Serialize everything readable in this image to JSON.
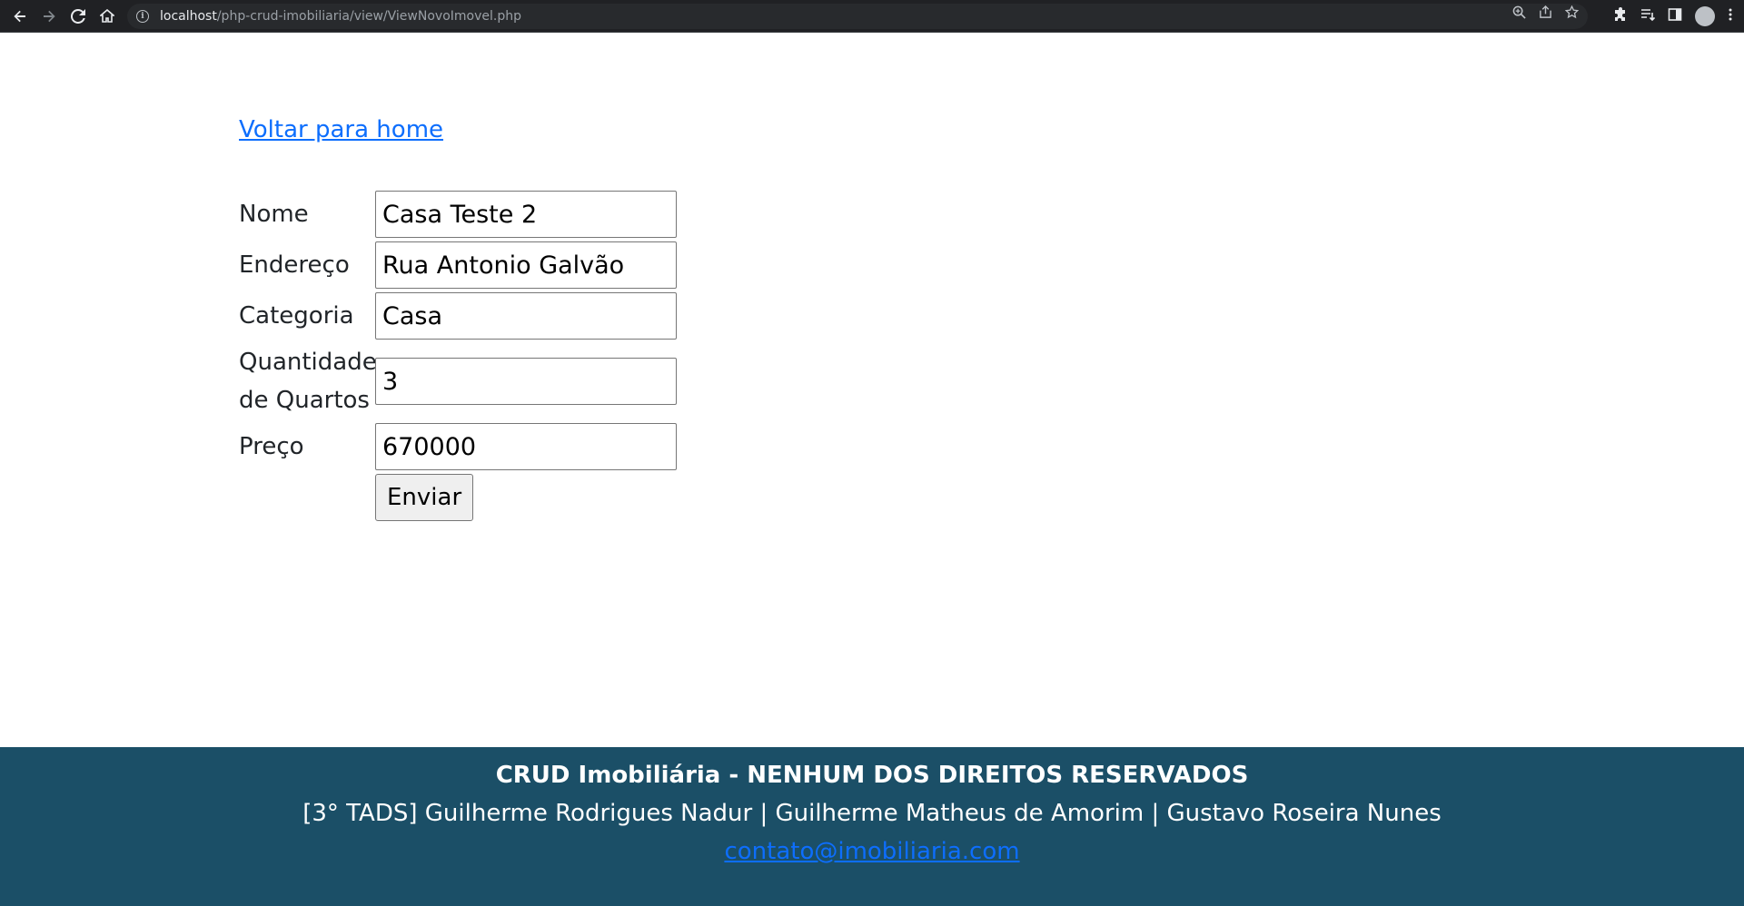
{
  "browser": {
    "url_host": "localhost",
    "url_path": "/php-crud-imobiliaria/view/ViewNovoImovel.php",
    "icons": {
      "back": "arrow-left-icon",
      "forward": "arrow-right-icon",
      "reload": "reload-icon",
      "home": "home-icon",
      "site_info": "info-icon",
      "zoom": "zoom-icon",
      "share": "share-icon",
      "bookmark": "star-icon",
      "extensions": "puzzle-icon",
      "reading_list": "reading-list-icon",
      "side_panel": "side-panel-icon",
      "profile": "avatar",
      "menu": "kebab-menu-icon"
    }
  },
  "page": {
    "back_link": "Voltar para home",
    "form": {
      "fields": [
        {
          "label": "Nome",
          "value": "Casa Teste 2"
        },
        {
          "label": "Endereço",
          "value": "Rua Antonio Galvão"
        },
        {
          "label": "Categoria",
          "value": "Casa"
        },
        {
          "label_line1": "Quantidade",
          "label_line2": "de Quartos",
          "value": "3"
        },
        {
          "label": "Preço",
          "value": "670000"
        }
      ],
      "submit_label": "Enviar"
    }
  },
  "footer": {
    "title": "CRUD Imobiliária - NENHUM DOS DIREITOS RESERVADOS",
    "authors": "[3° TADS] Guilherme Rodrigues Nadur | Guilherme Matheus de Amorim | Gustavo Roseira Nunes",
    "email": "contato@imobiliaria.com",
    "background_color": "#1b4f67",
    "link_color": "#0d6efd"
  }
}
